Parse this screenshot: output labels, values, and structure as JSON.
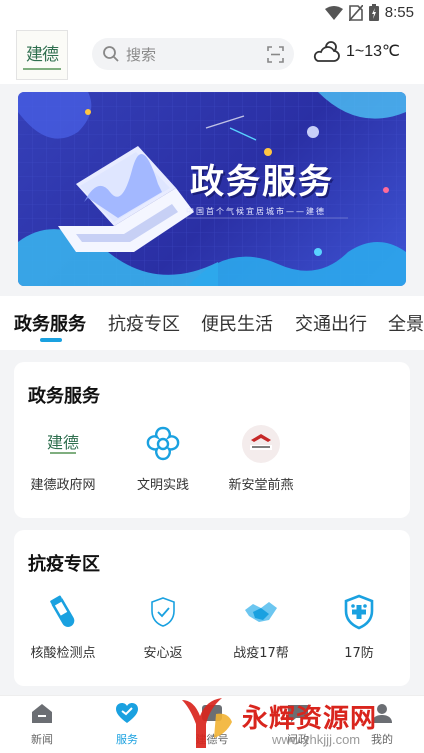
{
  "status_bar": {
    "time": "8:55"
  },
  "header": {
    "logo_text": "建德",
    "search_placeholder": "搜索",
    "weather": "1~13℃"
  },
  "banner": {
    "title": "政务服务",
    "subtitle": "中国首个气候宜居城市——建德"
  },
  "tabs": [
    {
      "label": "政务服务",
      "active": true
    },
    {
      "label": "抗疫专区"
    },
    {
      "label": "便民生活"
    },
    {
      "label": "交通出行"
    },
    {
      "label": "全景"
    }
  ],
  "sections": [
    {
      "title": "政务服务",
      "items": [
        {
          "label": "建德政府网",
          "icon": "jiande-logo-icon"
        },
        {
          "label": "文明实践",
          "icon": "flower-icon"
        },
        {
          "label": "新安堂前燕",
          "icon": "xinan-logo-icon"
        }
      ]
    },
    {
      "title": "抗疫专区",
      "items": [
        {
          "label": "核酸检测点",
          "icon": "test-tube-icon"
        },
        {
          "label": "安心返",
          "icon": "shield-check-icon"
        },
        {
          "label": "战疫17帮",
          "icon": "handshake-icon"
        },
        {
          "label": "17防",
          "icon": "shield-plus-icon"
        }
      ]
    }
  ],
  "bottom_nav": [
    {
      "label": "新闻",
      "icon": "home-icon"
    },
    {
      "label": "服务",
      "icon": "heart-icon",
      "active": true
    },
    {
      "label": "建德号",
      "icon": "media-icon"
    },
    {
      "label": "问政",
      "icon": "chat-icon"
    },
    {
      "label": "我的",
      "icon": "user-icon"
    }
  ],
  "watermark": {
    "text": "永辉资源网",
    "url": "www.yhkjjj.com"
  },
  "colors": {
    "accent": "#1aa1e0",
    "banner_blue": "#2f36b0",
    "watermark_red": "#d9251d"
  }
}
